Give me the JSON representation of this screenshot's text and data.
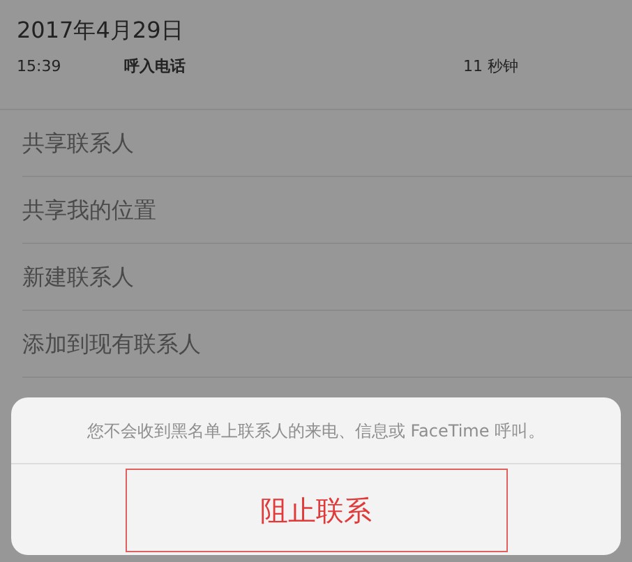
{
  "call_date": "2017年4月29日",
  "call": {
    "time": "15:39",
    "type": "呼入电话",
    "duration": "11 秒钟"
  },
  "actions": [
    {
      "label": "共享联系人"
    },
    {
      "label": "共享我的位置"
    },
    {
      "label": "新建联系人"
    },
    {
      "label": "添加到现有联系人"
    }
  ],
  "action_sheet": {
    "message": "您不会收到黑名单上联系人的来电、信息或 FaceTime 呼叫。",
    "button": "阻止联系"
  }
}
